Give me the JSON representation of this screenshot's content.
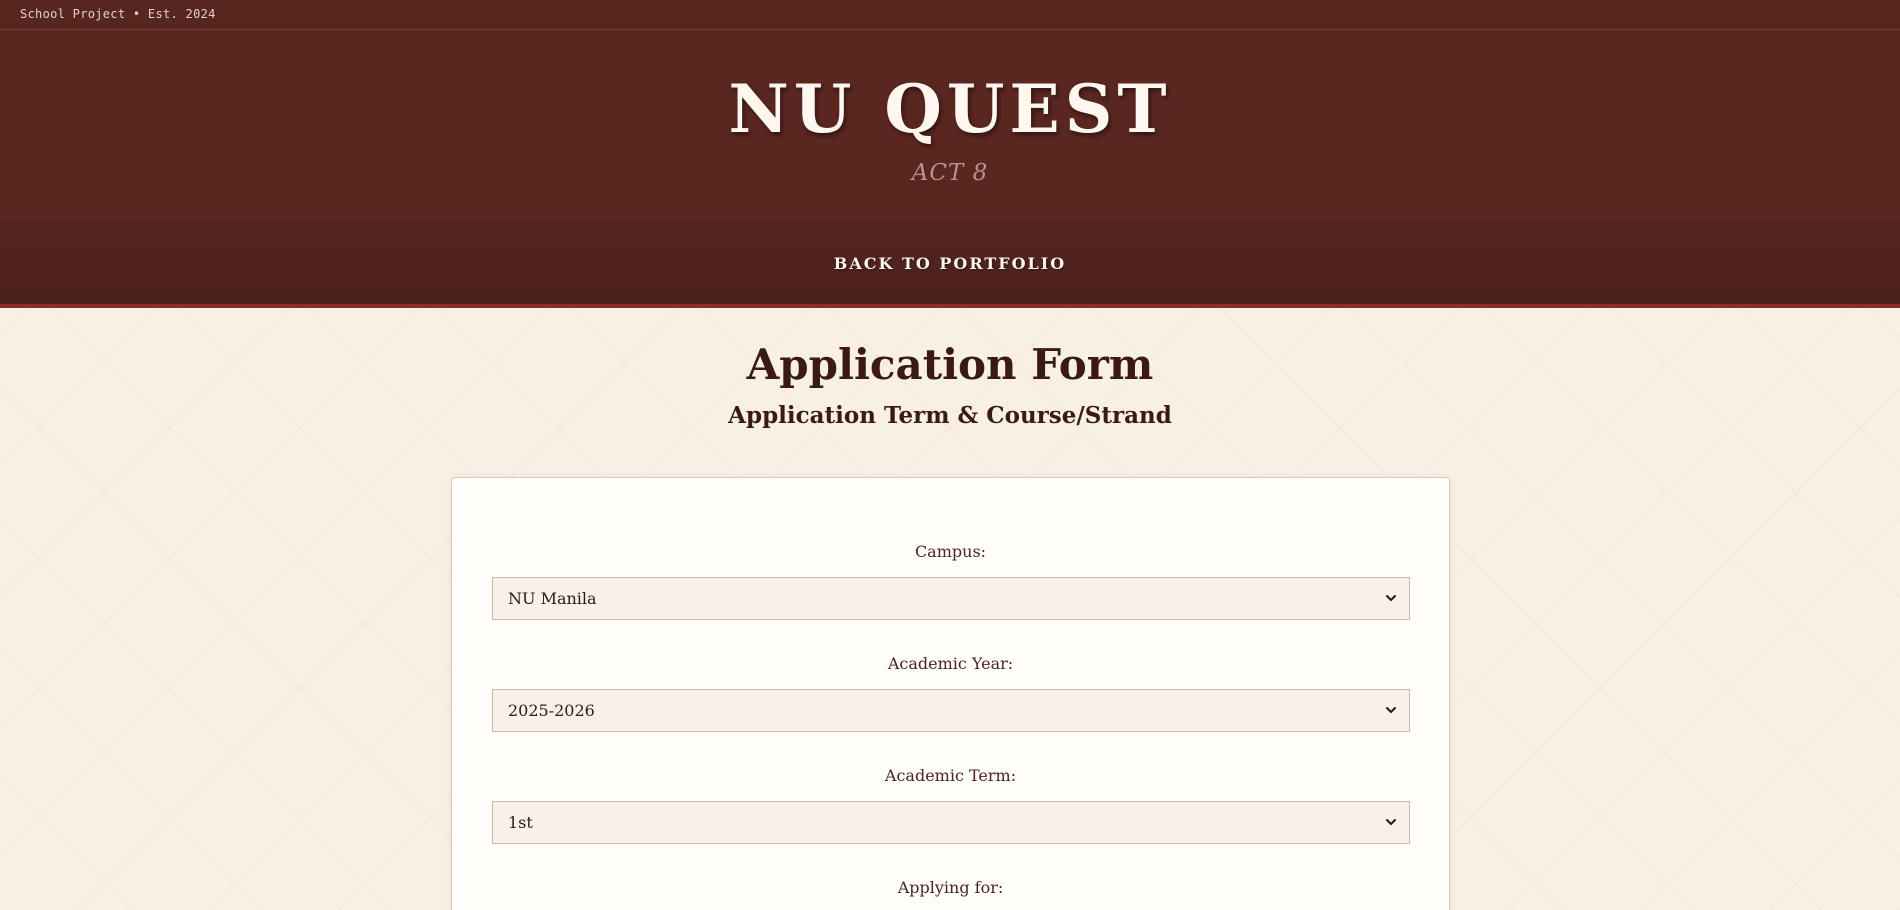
{
  "topbar": {
    "text": "School Project • Est. 2024"
  },
  "header": {
    "title": "NU QUEST",
    "subtitle": "ACT 8"
  },
  "nav": {
    "back_label": "BACK TO PORTFOLIO"
  },
  "form": {
    "title": "Application Form",
    "subtitle": "Application Term & Course/Strand",
    "fields": [
      {
        "label": "Campus:",
        "value": "NU Manila"
      },
      {
        "label": "Academic Year:",
        "value": "2025-2026"
      },
      {
        "label": "Academic Term:",
        "value": "1st"
      },
      {
        "label": "Applying for:"
      }
    ]
  },
  "colors": {
    "header_bg": "#5a2620",
    "nav_bg": "#4c221d",
    "accent_border": "#8e2c2a",
    "page_bg": "#f8f0e5",
    "select_bg": "#f8f1e8"
  },
  "icons": {
    "select_arrow": "chevron-down-icon"
  }
}
